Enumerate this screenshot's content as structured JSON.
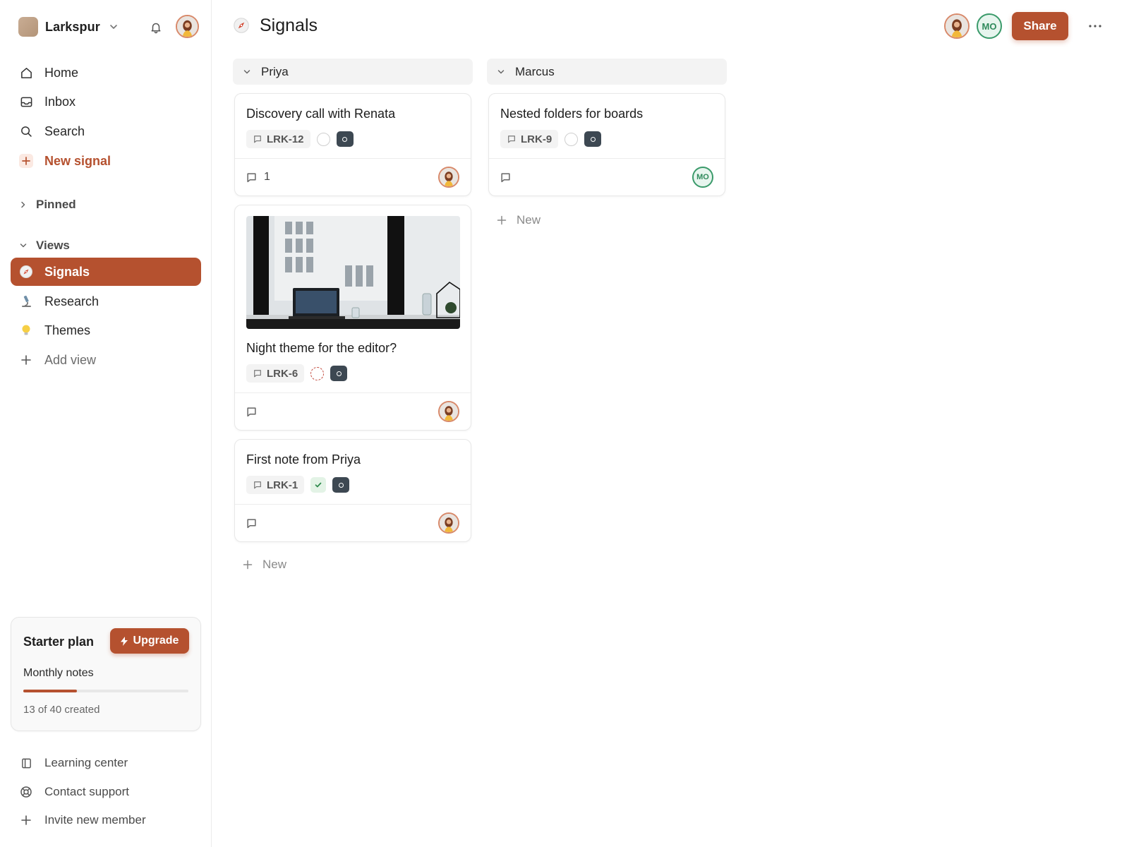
{
  "workspace": {
    "name": "Larkspur"
  },
  "sidebar": {
    "nav": [
      {
        "label": "Home",
        "icon": "home-icon"
      },
      {
        "label": "Inbox",
        "icon": "inbox-icon"
      },
      {
        "label": "Search",
        "icon": "search-icon"
      },
      {
        "label": "New signal",
        "icon": "plus-icon"
      }
    ],
    "pinned_label": "Pinned",
    "views_label": "Views",
    "views": [
      {
        "label": "Signals",
        "icon": "compass-icon",
        "active": true
      },
      {
        "label": "Research",
        "icon": "microscope-icon"
      },
      {
        "label": "Themes",
        "icon": "lightbulb-icon"
      },
      {
        "label": "Add view",
        "icon": "plus-icon"
      }
    ],
    "plan": {
      "title": "Starter plan",
      "upgrade_label": "Upgrade",
      "usage_label": "Monthly notes",
      "usage_text": "13 of 40 created",
      "used": 13,
      "limit": 40
    },
    "footer": [
      {
        "label": "Learning center",
        "icon": "book-icon"
      },
      {
        "label": "Contact support",
        "icon": "lifebuoy-icon"
      },
      {
        "label": "Invite new member",
        "icon": "plus-icon"
      }
    ]
  },
  "header": {
    "title": "Signals",
    "share_label": "Share",
    "member_initials": "MO"
  },
  "columns": [
    {
      "name": "Priya",
      "new_label": "New",
      "cards": [
        {
          "title": "Discovery call with Renata",
          "id": "LRK-12",
          "status": "todo",
          "comments": "1",
          "assignee": "avatar"
        },
        {
          "title": "Night theme for the editor?",
          "id": "LRK-6",
          "status": "in-review",
          "comments": "",
          "assignee": "avatar",
          "has_image": true
        },
        {
          "title": "First note from Priya",
          "id": "LRK-1",
          "status": "done",
          "comments": "",
          "assignee": "avatar"
        }
      ]
    },
    {
      "name": "Marcus",
      "new_label": "New",
      "cards": [
        {
          "title": "Nested folders for boards",
          "id": "LRK-9",
          "status": "todo",
          "comments": "",
          "assignee": "MO"
        }
      ]
    }
  ],
  "colors": {
    "accent": "#b5512f",
    "member_green": "#2f8a5c",
    "chip_dark": "#3d4852"
  }
}
